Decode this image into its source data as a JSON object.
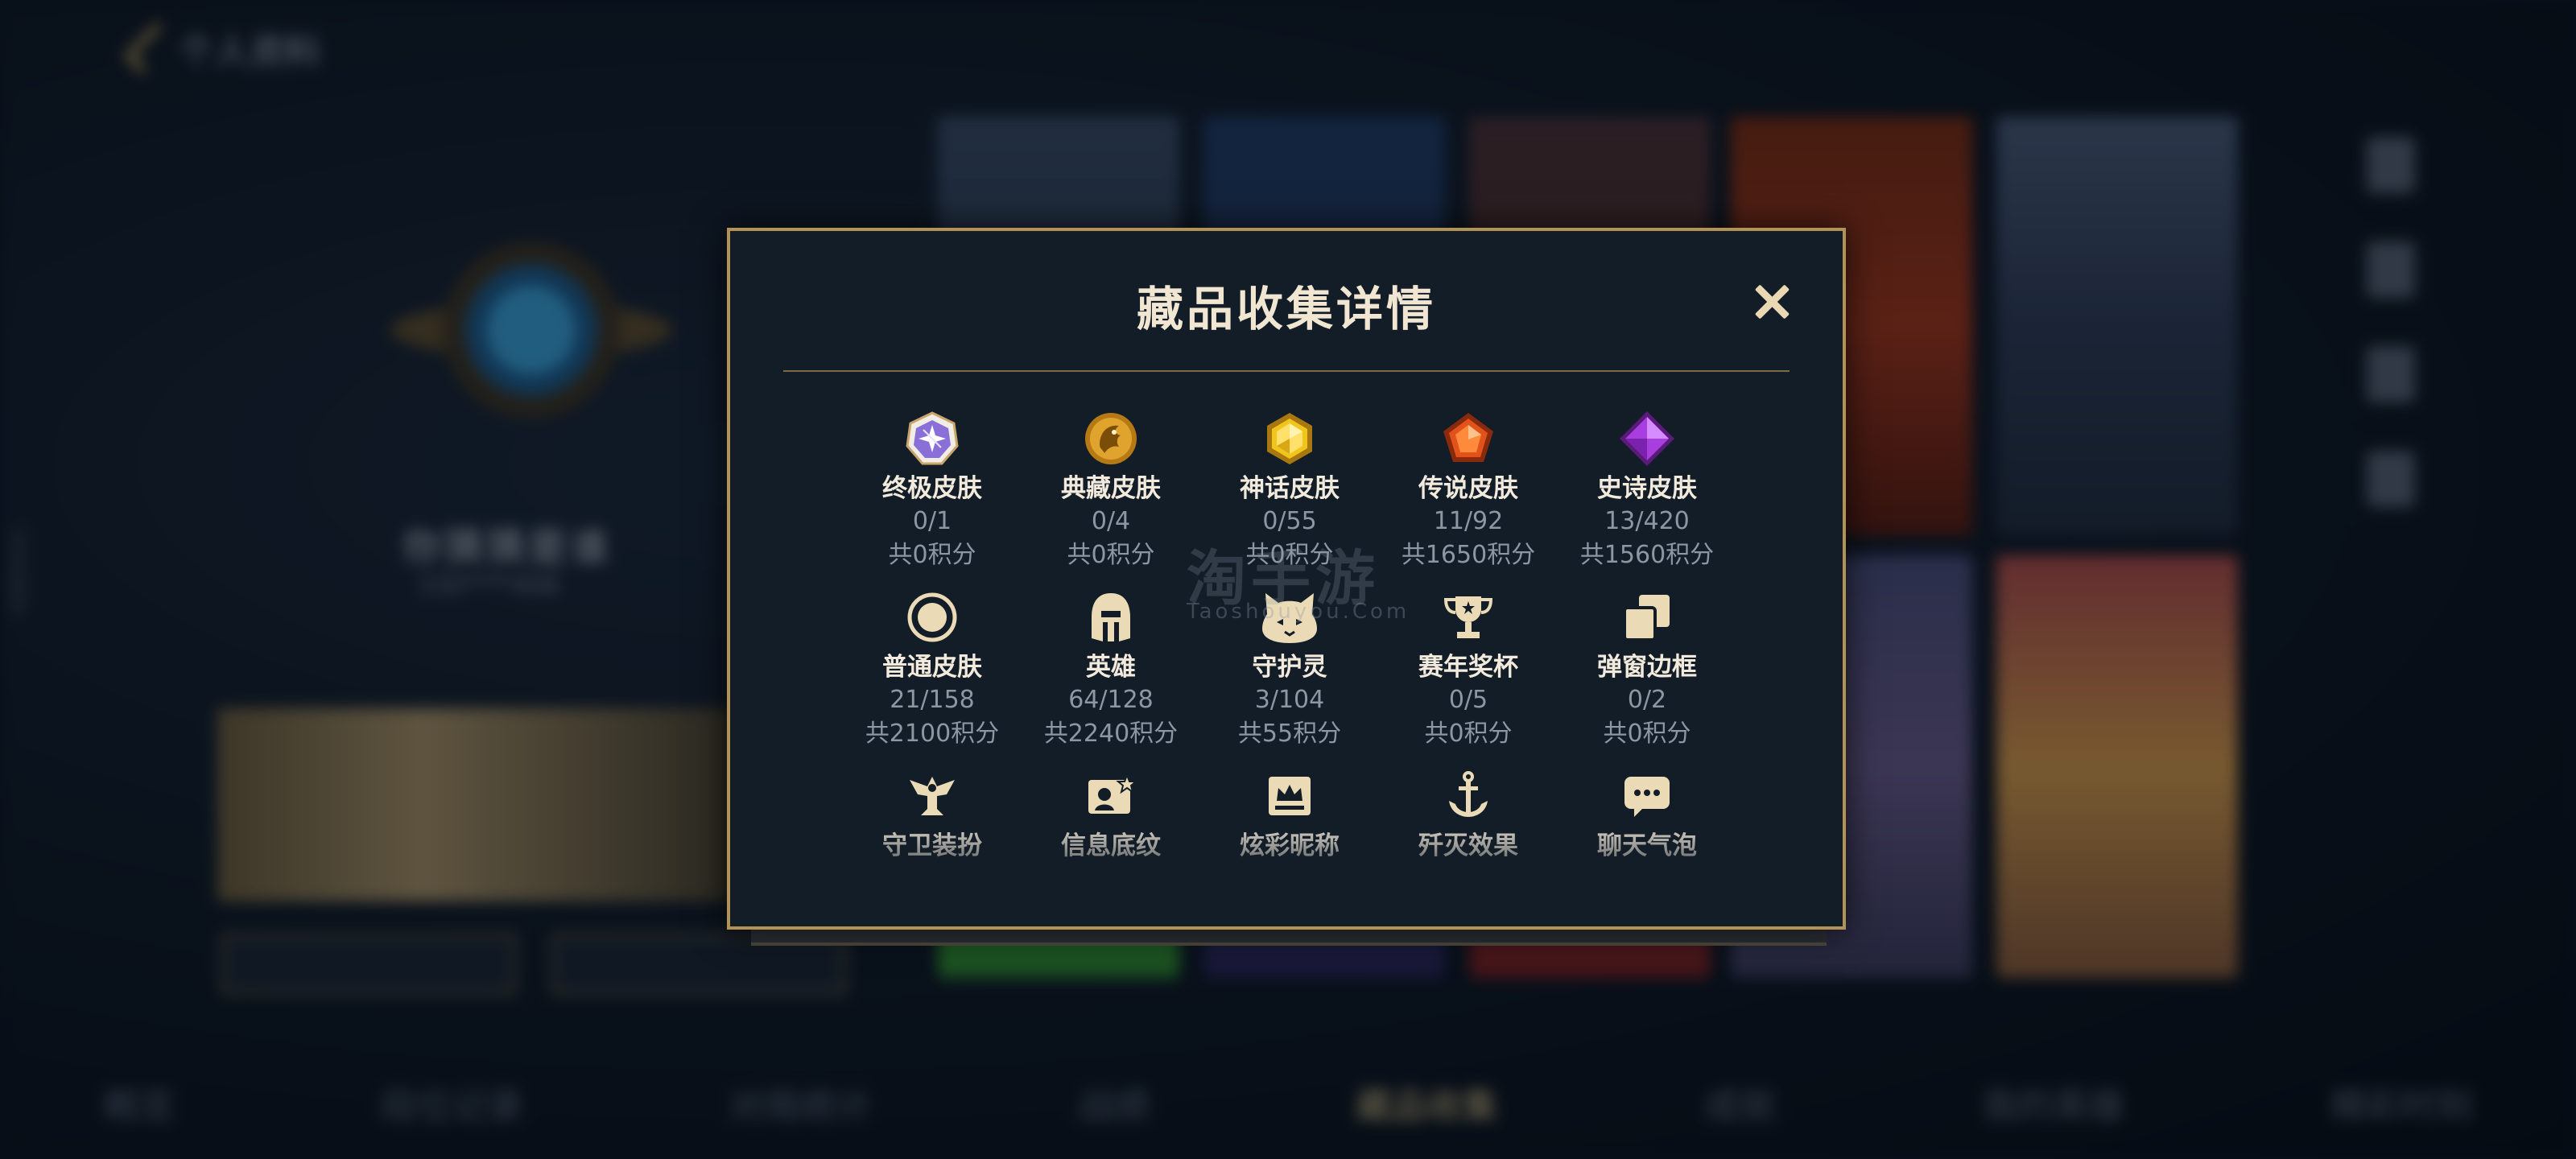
{
  "background": {
    "header_title": "个人资料",
    "player_name": "你猜猜是谁",
    "player_subtitle": "132****456",
    "vertical_id": "15058891",
    "tabs": [
      "概览",
      "段位记录",
      "对局统计",
      "战绩",
      "藏品收集",
      "成就",
      "我的英雄",
      "精彩时刻"
    ],
    "active_tab_index": 4
  },
  "modal": {
    "title": "藏品收集详情",
    "close_icon": "close-icon",
    "items": [
      {
        "name": "终极皮肤",
        "count": "0/1",
        "points": "共0积分",
        "icon": "ultimate-skin-icon",
        "color": "#b7a2f0"
      },
      {
        "name": "典藏皮肤",
        "count": "0/4",
        "points": "共0积分",
        "icon": "dragon-skin-icon",
        "color": "#d9a234"
      },
      {
        "name": "神话皮肤",
        "count": "0/55",
        "points": "共0积分",
        "icon": "mythic-skin-icon",
        "color": "#e8c21c"
      },
      {
        "name": "传说皮肤",
        "count": "11/92",
        "points": "共1650积分",
        "icon": "legendary-skin-icon",
        "color": "#e0521d"
      },
      {
        "name": "史诗皮肤",
        "count": "13/420",
        "points": "共1560积分",
        "icon": "epic-skin-icon",
        "color": "#a235d6"
      },
      {
        "name": "普通皮肤",
        "count": "21/158",
        "points": "共2100积分",
        "icon": "normal-skin-icon",
        "color": "#e8d6ad"
      },
      {
        "name": "英雄",
        "count": "64/128",
        "points": "共2240积分",
        "icon": "helmet-icon",
        "color": "#e8d6ad"
      },
      {
        "name": "守护灵",
        "count": "3/104",
        "points": "共55积分",
        "icon": "guardian-spirit-icon",
        "color": "#e8d6ad"
      },
      {
        "name": "赛年奖杯",
        "count": "0/5",
        "points": "共0积分",
        "icon": "trophy-icon",
        "color": "#e8d6ad"
      },
      {
        "name": "弹窗边框",
        "count": "0/2",
        "points": "共0积分",
        "icon": "popup-frame-icon",
        "color": "#e8d6ad"
      },
      {
        "name": "守卫装扮",
        "count": "",
        "points": "",
        "icon": "ward-skin-icon",
        "color": "#e8d6ad"
      },
      {
        "name": "信息底纹",
        "count": "",
        "points": "",
        "icon": "info-card-icon",
        "color": "#e8d6ad"
      },
      {
        "name": "炫彩昵称",
        "count": "",
        "points": "",
        "icon": "crown-nameplate-icon",
        "color": "#e8d6ad"
      },
      {
        "name": "歼灭效果",
        "count": "",
        "points": "",
        "icon": "anchor-icon",
        "color": "#e8d6ad"
      },
      {
        "name": "聊天气泡",
        "count": "",
        "points": "",
        "icon": "chat-bubble-icon",
        "color": "#e8d6ad"
      }
    ]
  },
  "watermark": {
    "text": "淘手游",
    "sub": "Taoshouyou.Com"
  }
}
